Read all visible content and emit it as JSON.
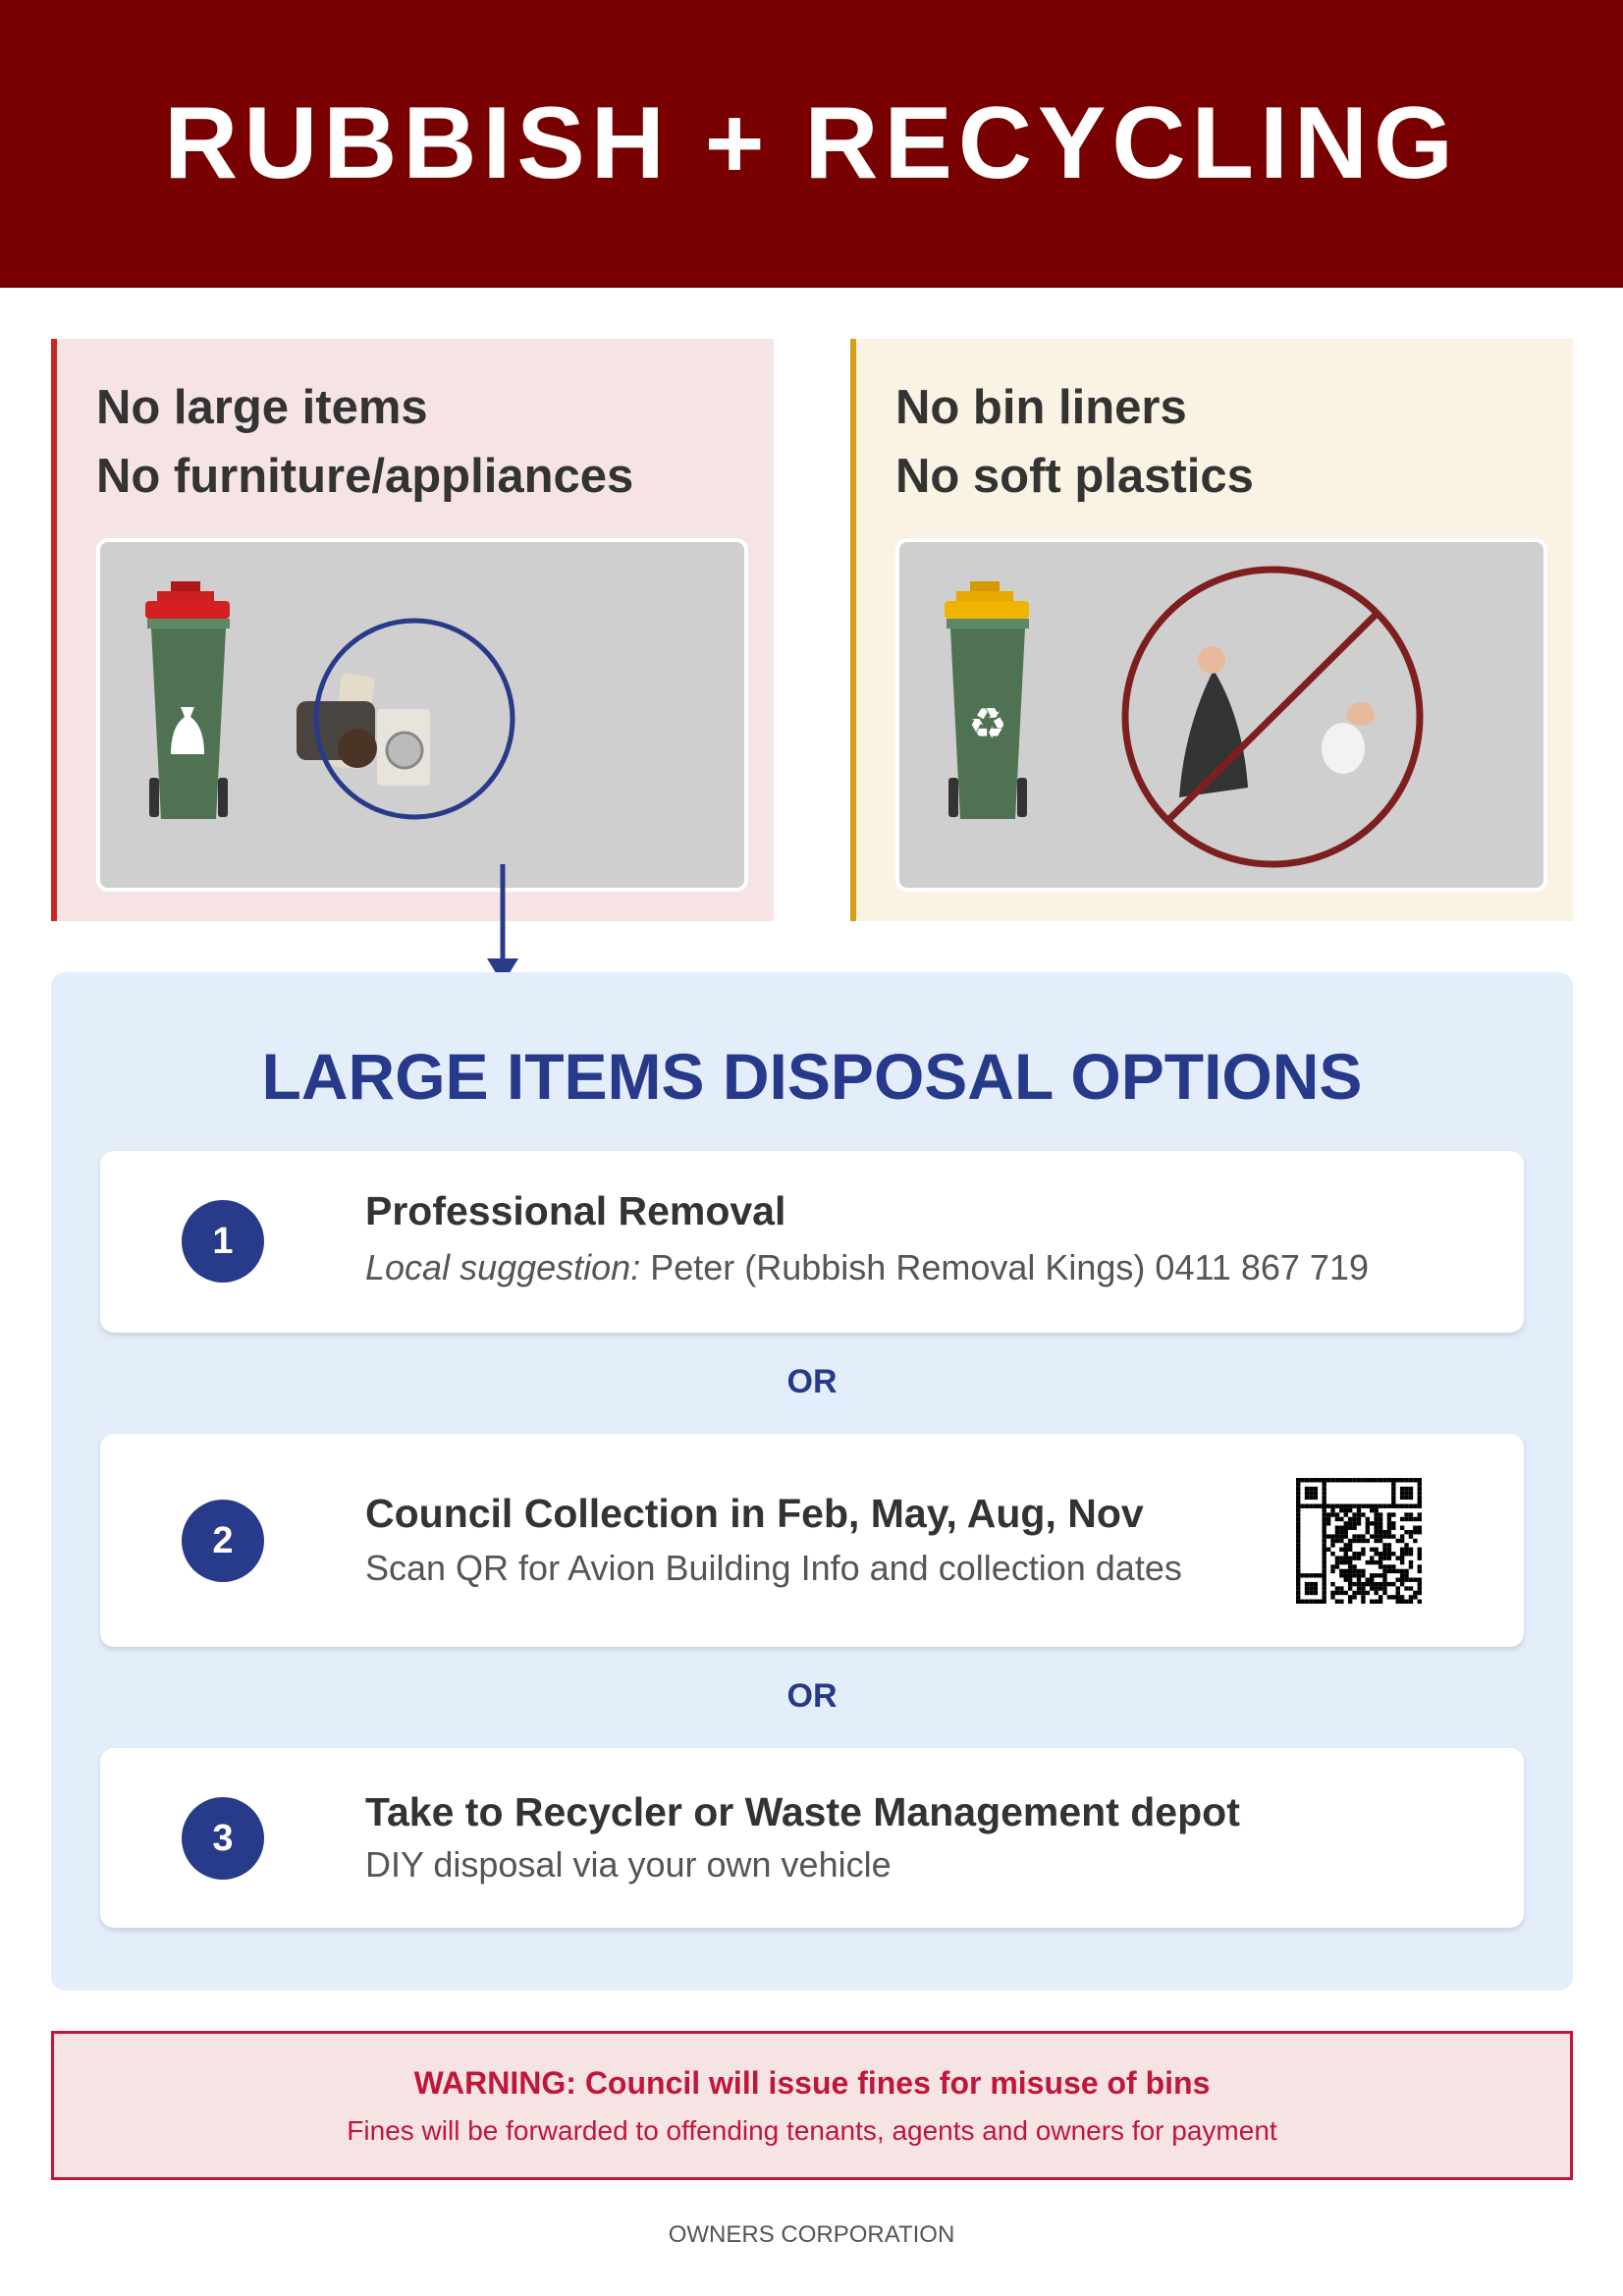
{
  "header": {
    "title": "RUBBISH + RECYCLING"
  },
  "panels": [
    {
      "lines": [
        "No large items",
        "No furniture/appliances"
      ],
      "accent": "#c62828",
      "bin_lid": "#cc1f1f",
      "icon": "large-items-icon"
    },
    {
      "lines": [
        "No bin liners",
        "No soft plastics"
      ],
      "accent": "#d4a017",
      "bin_lid": "#e8a800",
      "icon": "no-bags-icon"
    }
  ],
  "options": {
    "title": "LARGE ITEMS DISPOSAL OPTIONS",
    "or_label": "OR",
    "items": [
      {
        "number": "1",
        "title": "Professional Removal",
        "sub_italic": "Local suggestion:",
        "sub": " Peter (Rubbish Removal Kings) 0411 867 719"
      },
      {
        "number": "2",
        "title": "Council Collection in Feb, May, Aug, Nov",
        "sub": "Scan QR for Avion Building Info and collection dates"
      },
      {
        "number": "3",
        "title": "Take to Recycler or Waste Management depot",
        "sub": "DIY disposal via your own vehicle"
      }
    ]
  },
  "warning": {
    "title": "WARNING: Council will issue fines for misuse of bins",
    "sub": "Fines will be forwarded to offending tenants, agents and owners for payment"
  },
  "footer": "OWNERS CORPORATION"
}
